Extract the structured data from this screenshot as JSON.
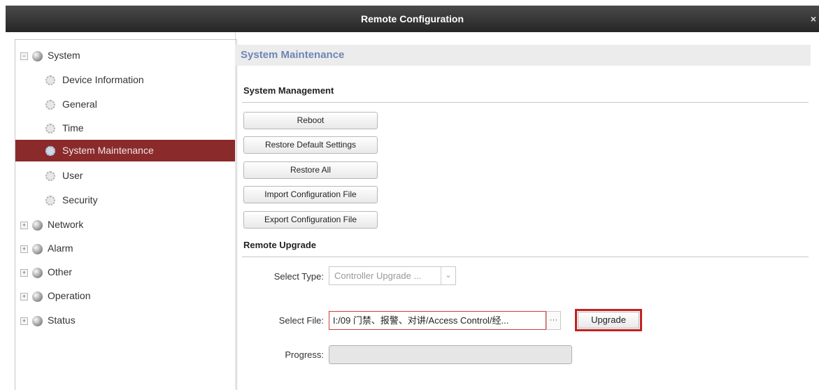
{
  "window": {
    "title": "Remote Configuration",
    "close_glyph": "×"
  },
  "sidebar": {
    "items": [
      {
        "label": "System",
        "icon": "globe-icon",
        "toggle": "−",
        "expanded": true
      },
      {
        "label": "Device Information",
        "icon": "gear-icon"
      },
      {
        "label": "General",
        "icon": "gear-icon"
      },
      {
        "label": "Time",
        "icon": "gear-icon"
      },
      {
        "label": "System Maintenance",
        "icon": "gear-icon",
        "selected": true
      },
      {
        "label": "User",
        "icon": "gear-icon"
      },
      {
        "label": "Security",
        "icon": "gear-icon"
      },
      {
        "label": "Network",
        "icon": "globe-icon",
        "toggle": "+"
      },
      {
        "label": "Alarm",
        "icon": "globe-icon",
        "toggle": "+"
      },
      {
        "label": "Other",
        "icon": "globe-icon",
        "toggle": "+"
      },
      {
        "label": "Operation",
        "icon": "globe-icon",
        "toggle": "+"
      },
      {
        "label": "Status",
        "icon": "globe-icon",
        "toggle": "+"
      }
    ],
    "selected_color": "#8b2a2a"
  },
  "main": {
    "header": "System Maintenance",
    "system_management": {
      "title": "System Management",
      "buttons": [
        "Reboot",
        "Restore Default Settings",
        "Restore All",
        "Import Configuration File",
        "Export Configuration File"
      ]
    },
    "remote_upgrade": {
      "title": "Remote Upgrade",
      "select_type_label": "Select Type:",
      "select_type_value": "Controller Upgrade ...",
      "select_file_label": "Select File:",
      "select_file_value": "I:/09 门禁、报警、对讲/Access Control/经...",
      "browse_label": "···",
      "upgrade_button": "Upgrade",
      "progress_label": "Progress:",
      "progress_value": 0
    },
    "accent_color": "#6f86b4",
    "highlight_color": "#c42020"
  }
}
